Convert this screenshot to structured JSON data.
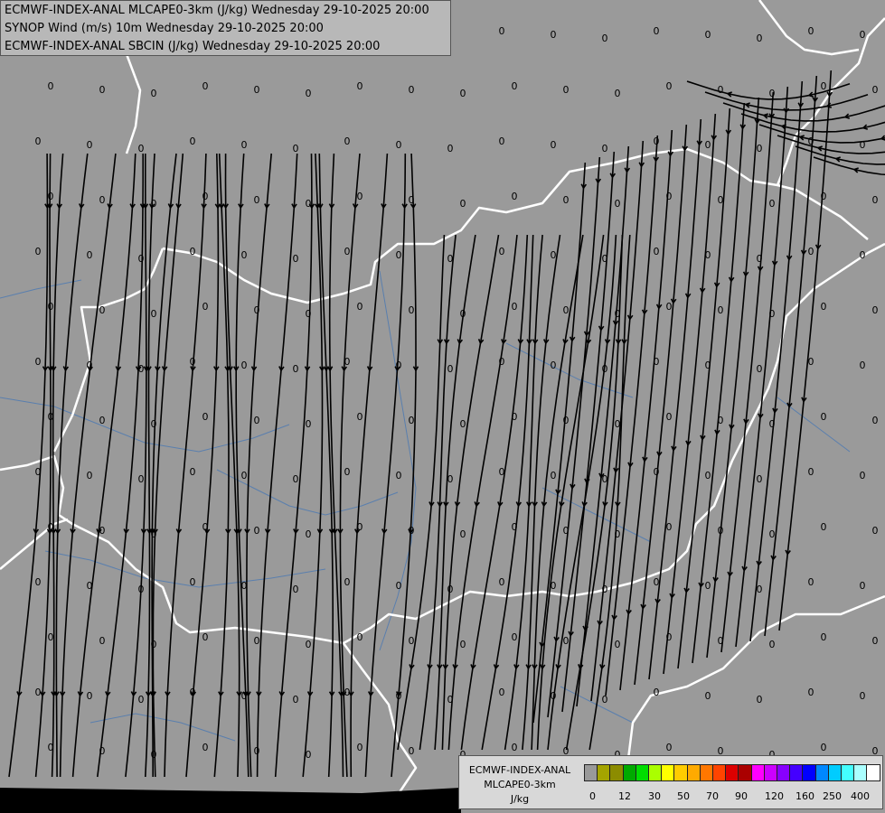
{
  "titles": {
    "line1": "ECMWF-INDEX-ANAL MLCAPE0-3km (J/kg) Wednesday 29-10-2025 20:00",
    "line2": "SYNOP Wind (m/s) 10m Wednesday 29-10-2025 20:00",
    "line3": "ECMWF-INDEX-ANAL SBCIN (J/kg) Wednesday 29-10-2025 20:00"
  },
  "legend": {
    "source": "ECMWF-INDEX-ANAL",
    "parameter": "MLCAPE0-3km",
    "unit": "J/kg",
    "colors": [
      "#999999",
      "#a4a400",
      "#8c8c00",
      "#00aa00",
      "#00dd00",
      "#aaff00",
      "#ffff00",
      "#ffcc00",
      "#ffaa00",
      "#ff7700",
      "#ff4400",
      "#dd0000",
      "#aa0000",
      "#ff00ff",
      "#cc00ff",
      "#8800ff",
      "#4400ff",
      "#0000ff",
      "#0088ff",
      "#00ccff",
      "#44ffff",
      "#aaffff",
      "#ffffff"
    ],
    "ticks": [
      "0",
      "12",
      "30",
      "50",
      "70",
      "90",
      "120",
      "160",
      "250",
      "400"
    ]
  },
  "map": {
    "background_color": "#9a9a9a",
    "border_color": "#ffffff",
    "river_color": "#5a7fae",
    "streamline_color": "#000000",
    "value_label": "0"
  }
}
